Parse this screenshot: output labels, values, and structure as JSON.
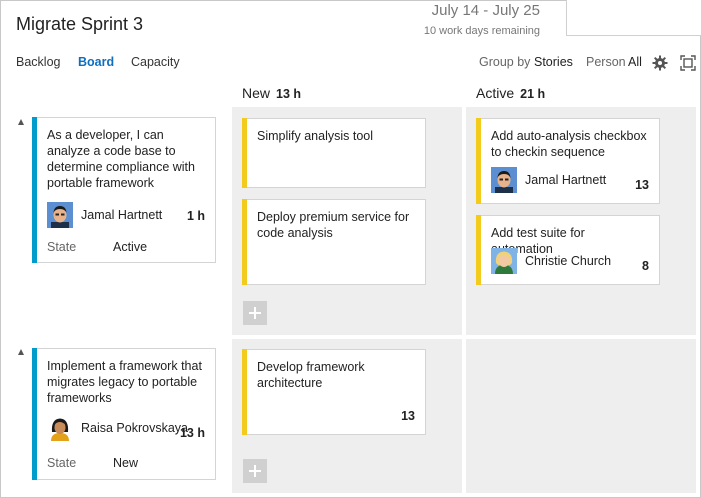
{
  "header": {
    "title": "Migrate Sprint 3",
    "date_range": "July 14 - July 25",
    "work_days": "10 work days remaining"
  },
  "tabs": [
    {
      "label": "Backlog",
      "active": false
    },
    {
      "label": "Board",
      "active": true
    },
    {
      "label": "Capacity",
      "active": false
    }
  ],
  "toolbar": {
    "group_by_label": "Group by",
    "group_by_value": "Stories",
    "person_label": "Person",
    "person_value": "All",
    "settings_icon": "gear-icon",
    "fullscreen_icon": "fullscreen-icon"
  },
  "columns": [
    {
      "name": "New",
      "count": "13 h"
    },
    {
      "name": "Active",
      "count": "21 h"
    }
  ],
  "lanes": [
    {
      "story": {
        "title": "As a developer, I can analyze a code base to determine compliance with portable framework",
        "assignee": "Jamal Hartnett",
        "effort": "1 h",
        "state_label": "State",
        "state_value": "Active"
      },
      "new_tasks": [
        {
          "title": "Simplify analysis tool"
        },
        {
          "title": "Deploy premium service for code analysis"
        }
      ],
      "active_tasks": [
        {
          "title": "Add auto-analysis checkbox to checkin sequence",
          "assignee": "Jamal Hartnett",
          "effort": "13"
        },
        {
          "title": "Add test suite for automation",
          "assignee": "Christie Church",
          "effort": "8"
        }
      ]
    },
    {
      "story": {
        "title": "Implement a framework that migrates legacy to portable frameworks",
        "assignee": "Raisa Pokrovskaya",
        "effort": "13 h",
        "state_label": "State",
        "state_value": "New"
      },
      "new_tasks": [
        {
          "title": "Develop framework architecture",
          "effort": "13"
        }
      ],
      "active_tasks": []
    }
  ],
  "colors": {
    "accent": "#106ebe",
    "story_bar": "#009ccc",
    "task_bar": "#f2cb1d",
    "lane_bg": "#eeeeee"
  }
}
